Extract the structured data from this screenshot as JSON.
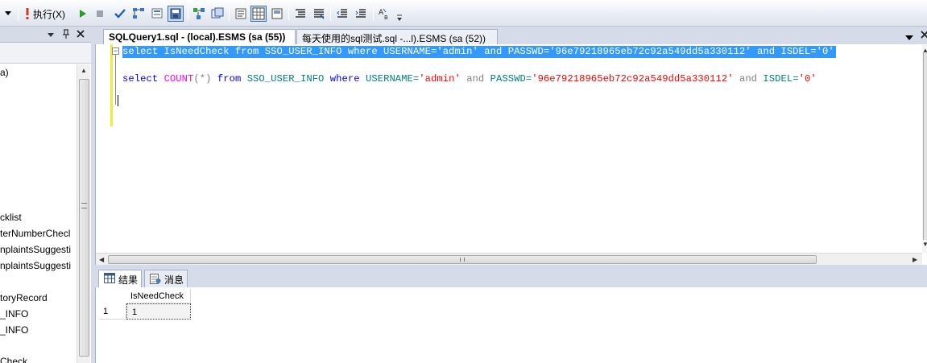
{
  "toolbar": {
    "execute_label": "执行(X)"
  },
  "left_pane": {
    "tree_items": [
      {
        "label": "a)"
      },
      {
        "label": "cklist"
      },
      {
        "label": "terNumberChecl"
      },
      {
        "label": "nplaintsSuggesti"
      },
      {
        "label": "nplaintsSuggesti"
      },
      {
        "label": "toryRecord"
      },
      {
        "label": "_INFO"
      },
      {
        "label": "_INFO"
      },
      {
        "label": "Check"
      }
    ]
  },
  "editor": {
    "tabs": [
      {
        "label": "SQLQuery1.sql - (local).ESMS (sa (55))",
        "active": true
      },
      {
        "label": "每天使用的sql测试.sql -...l).ESMS (sa (52))",
        "active": false
      }
    ],
    "line1": {
      "select": "select",
      "cols": " IsNeedCheck ",
      "from": "from",
      "table": " SSO_USER_INFO ",
      "where": "where",
      "c1": " USERNAME=",
      "v1": "'admin'",
      "and1": " and ",
      "c2": "PASSWD=",
      "v2": "'96e79218965eb72c92a549dd5a330112'",
      "and2": " and ",
      "c3": "ISDEL=",
      "v3": "'0'"
    },
    "line2": {
      "select": "select",
      "count": "COUNT",
      "args": "(*)",
      "from": "from",
      "table": " SSO_USER_INFO ",
      "where": "where",
      "c1": " USERNAME=",
      "v1": "'admin'",
      "and1": "and",
      "c2": " PASSWD=",
      "v2": "'96e79218965eb72c92a549dd5a330112'",
      "and2": "and",
      "c3": " ISDEL=",
      "v3": "'0'"
    }
  },
  "results": {
    "tabs": [
      {
        "label": "结果",
        "active": true
      },
      {
        "label": "消息",
        "active": false
      }
    ],
    "columns": [
      "IsNeedCheck"
    ],
    "rows": [
      {
        "row_number": "1",
        "values": [
          "1"
        ]
      }
    ]
  }
}
